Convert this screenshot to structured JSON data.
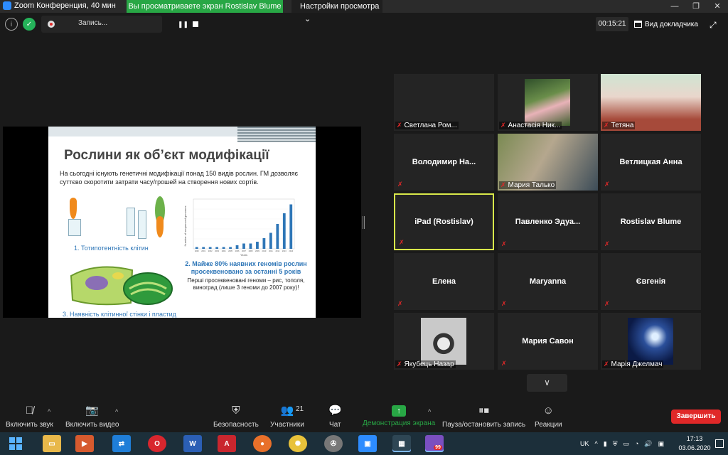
{
  "window": {
    "title": "Zoom Конференция, 40 мин",
    "share_banner": "Вы просматриваете экран Rostislav Blume",
    "view_settings": "Настройки просмотра",
    "controls": [
      "—",
      "❐",
      "✕"
    ]
  },
  "topbar": {
    "recording_label": "Запись...",
    "timer": "00:15:21",
    "speaker_view_label": "Вид докладчика"
  },
  "slide": {
    "title": "Рослини як об’єкт модифікації",
    "intro": "На сьогодні існують генетичні модифікації понад 150 видів рослин. ГМ дозволяє суттєво скоротити затрати часу/грошей на створення нових сортів.",
    "caption1": "1. Тотипотентність клітин",
    "caption2": "2. Майже 80% наявних геномів рослин просеквеновано за останні 5 років",
    "caption2_note": "Перші просеквеновані геноми – рис, тополя, виноград (лише 3 геноми до 2007 року)!",
    "caption3": "3. Наявність клітинної стінки і пластид"
  },
  "chart_data": {
    "type": "bar",
    "categories": [
      "2000",
      "2001",
      "2002",
      "2003",
      "2004",
      "2005",
      "2006",
      "2007",
      "2008",
      "2009",
      "2010",
      "2011",
      "2012",
      "2013",
      "2014"
    ],
    "values": [
      1,
      1,
      1,
      1,
      1,
      1,
      2,
      3,
      3,
      4,
      6,
      9,
      14,
      20,
      25
    ],
    "ylim": [
      0,
      28
    ],
    "ylabel": "Number of sequenced genomes",
    "xlabel": "Years",
    "bar_color": "#2e76b7"
  },
  "participants": [
    {
      "name": "Светлана Ром...",
      "muted": true,
      "video": "none"
    },
    {
      "name": "Анастасія Ник...",
      "muted": true,
      "video": "anastasia"
    },
    {
      "name": "Тетяна",
      "muted": true,
      "video": "tetyana"
    },
    {
      "name": "Володимир  На...",
      "muted": true,
      "video": "name"
    },
    {
      "name": "Мария Талько",
      "muted": true,
      "video": "maria"
    },
    {
      "name": "Ветлицкая Анна",
      "muted": true,
      "video": "name"
    },
    {
      "name": "iPad (Rostislav)",
      "muted": true,
      "video": "name",
      "active": true
    },
    {
      "name": "Павленко  Эдуа...",
      "muted": true,
      "video": "name"
    },
    {
      "name": "Rostislav Blume",
      "muted": true,
      "video": "name"
    },
    {
      "name": "Елена",
      "muted": true,
      "video": "name"
    },
    {
      "name": "Maryanna",
      "muted": true,
      "video": "name"
    },
    {
      "name": "Євгенія",
      "muted": true,
      "video": "name"
    },
    {
      "name": "Якубець Назар",
      "muted": true,
      "video": "raccoon"
    },
    {
      "name": "Мария Савон",
      "muted": true,
      "video": "name"
    },
    {
      "name": "Марія Джелмач",
      "muted": true,
      "video": "art"
    }
  ],
  "toolbar": {
    "unmute_label": "Включить звук",
    "start_video_label": "Включить видео",
    "security_label": "Безопасность",
    "participants_label": "Участники",
    "participants_count": "21",
    "chat_label": "Чат",
    "share_label": "Демонстрация экрана",
    "pause_record_label": "Пауза/остановить запись",
    "reactions_label": "Реакции",
    "end_label": "Завершить"
  },
  "taskbar": {
    "lang": "UK",
    "time": "17:13",
    "date": "03.06.2020",
    "viber_badge": "99"
  }
}
